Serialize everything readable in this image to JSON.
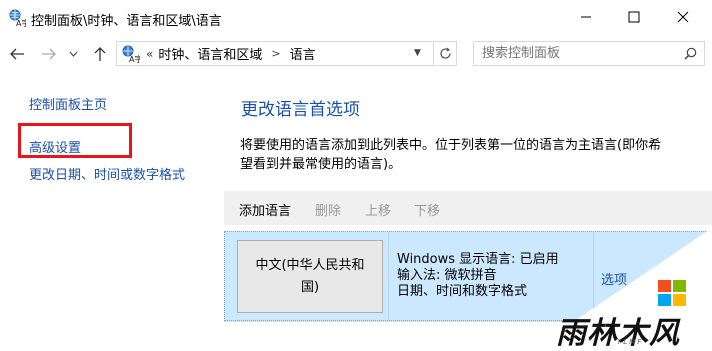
{
  "window": {
    "title": "控制面板\\时钟、语言和区域\\语言"
  },
  "address": {
    "overflow": "«",
    "segments": [
      "时钟、语言和区域",
      "语言"
    ]
  },
  "search": {
    "placeholder": "搜索控制面板"
  },
  "sidebar": {
    "items": [
      {
        "label": "控制面板主页"
      },
      {
        "label": "高级设置"
      },
      {
        "label": "更改日期、时间或数字格式"
      }
    ]
  },
  "main": {
    "title": "更改语言首选项",
    "description": "将要使用的语言添加到此列表中。位于列表第一位的语言为主语言(即你希望看到并最常使用的语言)。",
    "toolbar": {
      "add": "添加语言",
      "remove": "删除",
      "up": "上移",
      "down": "下移"
    },
    "languages": [
      {
        "name": "中文(中华人民共和国)",
        "details": [
          "Windows 显示语言: 已启用",
          "输入法: 微软拼音",
          "日期、时间和数字格式"
        ],
        "options": "选项"
      }
    ]
  },
  "watermark": {
    "text": "雨林木风",
    "sub": "YLMF"
  },
  "colors": {
    "link": "#1a50a8",
    "highlight_box": "#e8141c",
    "selected_row": "#cce8ff",
    "toolbar_bg": "#f0f0f0"
  }
}
